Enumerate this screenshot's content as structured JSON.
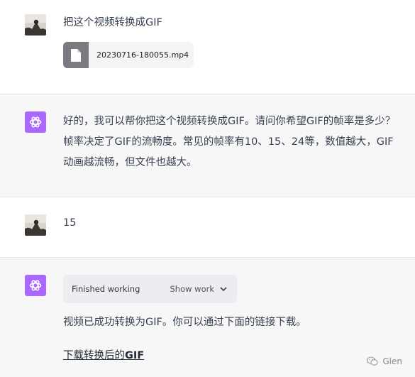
{
  "messages": [
    {
      "role": "user",
      "text": "把这个视频转换成GIF",
      "attachment": {
        "name": "20230716-180055.mp4",
        "icon": "file-icon"
      }
    },
    {
      "role": "assistant",
      "text": "好的，我可以帮你把这个视频转换成GIF。请问你希望GIF的帧率是多少？帧率决定了GIF的流畅度。常见的帧率有10、15、24等，数值越大，GIF动画越流畅，但文件也越大。"
    },
    {
      "role": "user",
      "text": "15"
    },
    {
      "role": "assistant",
      "work": {
        "status": "Finished working",
        "toggle_label": "Show work",
        "toggle_icon": "chevron-down-icon"
      },
      "text": "视频已成功转换为GIF。你可以通过下面的链接下载。",
      "link": {
        "prefix": "下载转换后的",
        "bold": "GIF"
      }
    }
  ],
  "watermark": {
    "label": "Glen",
    "icon": "wechat-icon"
  },
  "colors": {
    "assistant_bg": "#f7f7f8",
    "gpt_avatar": "#ab68ff",
    "work_box_bg": "#ececf1"
  }
}
